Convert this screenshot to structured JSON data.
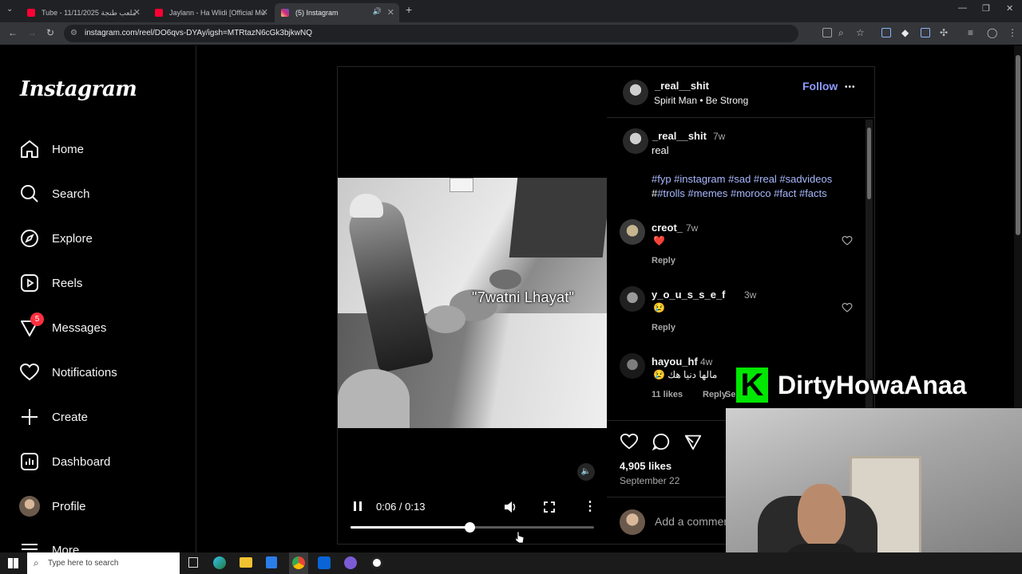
{
  "browser": {
    "tabs": [
      {
        "label": "Tube - 11/11/2025 ملعب طنجة",
        "active": false
      },
      {
        "label": "Jaylann - Ha Wlidi [Official Mu",
        "active": false
      },
      {
        "label": "(5) Instagram",
        "active": true
      }
    ],
    "url": "instagram.com/reel/DO6qvs-DYAy/igsh=MTRtazN6cGk3bjkwNQ"
  },
  "sidebar": {
    "logo": "Instagram",
    "items": [
      {
        "label": "Home",
        "icon": "home-icon"
      },
      {
        "label": "Search",
        "icon": "search-icon"
      },
      {
        "label": "Explore",
        "icon": "compass-icon"
      },
      {
        "label": "Reels",
        "icon": "reels-icon"
      },
      {
        "label": "Messages",
        "icon": "messenger-icon",
        "badge": "5"
      },
      {
        "label": "Notifications",
        "icon": "heart-icon"
      },
      {
        "label": "Create",
        "icon": "plus-icon"
      },
      {
        "label": "Dashboard",
        "icon": "dashboard-icon"
      },
      {
        "label": "Profile",
        "icon": "profile-avatar"
      },
      {
        "label": "More",
        "icon": "menu-icon"
      }
    ]
  },
  "post": {
    "author": "_real__shit",
    "audio": "Spirit Man • Be Strong",
    "follow_label": "Follow",
    "more_label": "•••",
    "video_overlay_text": "\"7watni Lhayat\"",
    "time_display": "0:06 / 0:13",
    "progress": 0.49,
    "caption": {
      "username": "_real__shit",
      "age": "7w",
      "text": "real",
      "hashtags_line1": "#fyp #instagram #sad #real #sadvideos",
      "hashtags_line2_prefix": "#",
      "hashtags_line2": "#trolls #memes #moroco #fact #facts"
    },
    "comments": [
      {
        "username": "creot_",
        "age": "7w",
        "text": "❤️",
        "reply": "Reply",
        "likes": ""
      },
      {
        "username": "y_o_u_s_s_e_f",
        "age": "3w",
        "text": "😢",
        "reply": "Reply",
        "likes": ""
      },
      {
        "username": "hayou_hf",
        "age": "4w",
        "text": "😢 مالها دنيا هك",
        "reply": "Reply",
        "likes": "11 likes",
        "see_translation": "Se"
      }
    ],
    "likes": "4,905 likes",
    "date": "September 22",
    "add_comment_placeholder": "Add a comment..."
  },
  "overlay": {
    "brand_text": "DirtyHowaAnaa",
    "brand_color": "#00e701"
  },
  "taskbar": {
    "search_placeholder": "Type here to search"
  }
}
